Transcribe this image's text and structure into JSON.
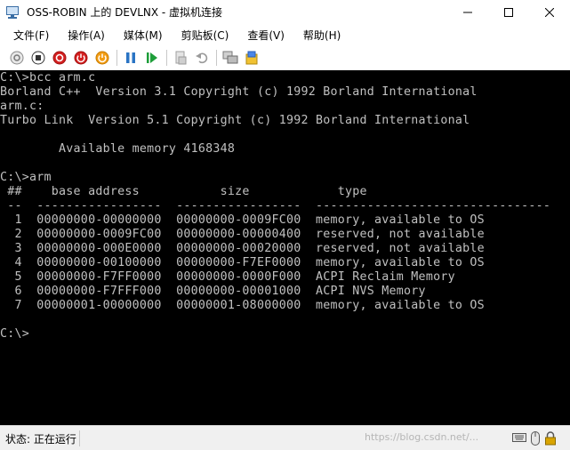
{
  "window": {
    "title": "OSS-ROBIN 上的 DEVLNX - 虚拟机连接"
  },
  "menu": {
    "items": [
      "文件(F)",
      "操作(A)",
      "媒体(M)",
      "剪贴板(C)",
      "查看(V)",
      "帮助(H)"
    ]
  },
  "toolbar": {
    "buttons": [
      {
        "name": "ctrl-alt-del-icon"
      },
      {
        "name": "start-icon"
      },
      {
        "name": "turn-off-icon"
      },
      {
        "name": "shutdown-icon"
      },
      {
        "name": "power-icon"
      },
      {
        "name": "pause-icon"
      },
      {
        "name": "resume-icon"
      },
      {
        "name": "checkpoint-icon"
      },
      {
        "name": "revert-icon"
      },
      {
        "name": "enhanced-session-icon"
      },
      {
        "name": "share-icon"
      }
    ]
  },
  "console": {
    "lines": [
      "C:\\>bcc arm.c",
      "Borland C++  Version 3.1 Copyright (c) 1992 Borland International",
      "arm.c:",
      "Turbo Link  Version 5.1 Copyright (c) 1992 Borland International",
      "",
      "        Available memory 4168348",
      "",
      "C:\\>arm",
      " ##    base address           size            type",
      " --  -----------------  -----------------  --------------------------------",
      "  1  00000000-00000000  00000000-0009FC00  memory, available to OS",
      "  2  00000000-0009FC00  00000000-00000400  reserved, not available",
      "  3  00000000-000E0000  00000000-00020000  reserved, not available",
      "  4  00000000-00100000  00000000-F7EF0000  memory, available to OS",
      "  5  00000000-F7FF0000  00000000-0000F000  ACPI Reclaim Memory",
      "  6  00000000-F7FFF000  00000000-00001000  ACPI NVS Memory",
      "  7  00000001-00000000  00000001-08000000  memory, available to OS",
      "",
      "C:\\>"
    ]
  },
  "status": {
    "text": "状态: 正在运行",
    "watermark": "https://blog.csdn.net/..."
  }
}
